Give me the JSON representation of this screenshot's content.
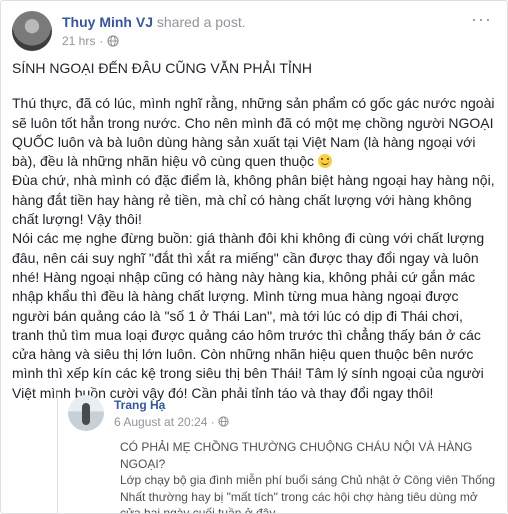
{
  "post": {
    "author": "Thuy Minh VJ",
    "action": "shared a post.",
    "time": "21 hrs",
    "privacy_icon": "globe-icon",
    "more_icon": "more-options-icon",
    "title": "SÍNH NGOẠI ĐẾN ĐÂU CŨNG VẪN PHẢI TỈNH",
    "paragraphs": [
      "Thú thực, đã có lúc, mình nghĩ rằng, những sản phẩm có gốc gác nước ngoài sẽ luôn tốt hẳn trong nước. Cho nên mình đã có một mẹ chồng người NGOẠI QUỐC luôn và bà luôn dùng hàng sản xuất tại Việt Nam (là hàng ngoại với bà), đều là những nhãn hiệu vô cùng quen thuộc",
      "Đùa chứ, nhà mình có đặc điểm là, không phân biệt hàng ngoại hay hàng nội, hàng đắt tiền hay hàng rẻ tiền, mà chỉ có hàng chất lượng với hàng không chất lượng! Vậy thôi!",
      "Nói các mẹ nghe đừng buồn: giá thành đôi khi không đi cùng với chất lượng đâu, nên cái suy nghĩ \"đắt thì xắt ra miếng\" cần được thay đổi ngay và luôn nhé! Hàng ngoại nhập cũng có hàng này hàng kia, không phải cứ gắn mác nhập khẩu thì đều là hàng chất lượng. Mình từng mua hàng ngoại được người bán quảng cáo là \"số 1 ở Thái Lan\", mà tới lúc có dịp đi Thái chơi, tranh thủ tìm mua loại được quảng cáo hôm trước thì chẳng thấy bán ở các cửa hàng và siêu thị lớn luôn. Còn những nhãn hiệu quen thuộc bên nước mình thì xếp kín các kệ trong siêu thị bên Thái! Tâm lý sính ngoại của người Việt mình buồn cười vậy đó! Cần phải tỉnh táo và thay đổi ngay thôi!"
    ],
    "emoji": "smile-emoji"
  },
  "shared_post": {
    "author": "Trang Hạ",
    "date": "6 August at 20:24",
    "privacy_icon": "globe-icon",
    "title": "CÓ PHẢI MẸ CHỒNG THƯỜNG CHUỘNG CHÁU NỘI VÀ HÀNG NGOẠI?",
    "text": "Lớp chạy bộ gia đình miễn phí buổi sáng Chủ nhật ở Công viên Thống Nhất thường hay bị \"mất tích\" trong các hội chợ hàng tiêu dùng mở cửa hai ngày cuối tuần ở đây."
  },
  "colors": {
    "link": "#365899",
    "muted": "#90949c",
    "text": "#1d2129",
    "border": "#dddfe2"
  }
}
